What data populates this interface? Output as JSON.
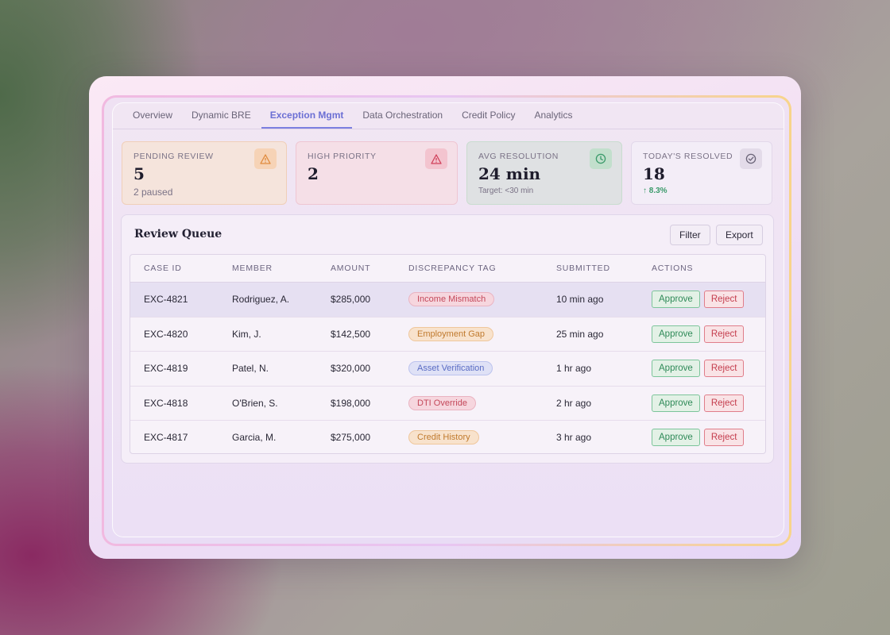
{
  "tabs": [
    "Overview",
    "Dynamic BRE",
    "Exception Mgmt",
    "Data Orchestration",
    "Credit Policy",
    "Analytics"
  ],
  "active_tab": "Exception Mgmt",
  "stats": {
    "pending": {
      "label": "PENDING REVIEW",
      "value": "5",
      "sub": "2 paused",
      "icon": "warning-triangle-icon"
    },
    "priority": {
      "label": "HIGH PRIORITY",
      "value": "2",
      "icon": "alert-triangle-icon"
    },
    "resolution": {
      "label": "AVG RESOLUTION",
      "value": "24 min",
      "sub": "Target: <30 min",
      "icon": "clock-icon"
    },
    "resolved": {
      "label": "TODAY'S RESOLVED",
      "value": "18",
      "sub": "↑ 8.3%",
      "icon": "check-circle-icon"
    }
  },
  "queue": {
    "title": "Review Queue",
    "filter_label": "Filter",
    "export_label": "Export",
    "columns": [
      "CASE ID",
      "MEMBER",
      "AMOUNT",
      "DISCREPANCY TAG",
      "SUBMITTED",
      "ACTIONS"
    ],
    "rows": [
      {
        "case_id": "EXC-4821",
        "member": "Rodriguez, A.",
        "amount": "$285,000",
        "tag": "Income Mismatch",
        "submitted": "10 min ago",
        "approve": "Approve",
        "reject": "Reject"
      },
      {
        "case_id": "EXC-4820",
        "member": "Kim, J.",
        "amount": "$142,500",
        "tag": "Employment Gap",
        "submitted": "25 min ago",
        "approve": "Approve",
        "reject": "Reject"
      },
      {
        "case_id": "EXC-4819",
        "member": "Patel, N.",
        "amount": "$320,000",
        "tag": "Asset Verification",
        "submitted": "1 hr ago",
        "approve": "Approve",
        "reject": "Reject"
      },
      {
        "case_id": "EXC-4818",
        "member": "O'Brien, S.",
        "amount": "$198,000",
        "tag": "DTI Override",
        "submitted": "2 hr ago",
        "approve": "Approve",
        "reject": "Reject"
      },
      {
        "case_id": "EXC-4817",
        "member": "Garcia, M.",
        "amount": "$275,000",
        "tag": "Credit History",
        "submitted": "3 hr ago",
        "approve": "Approve",
        "reject": "Reject"
      }
    ]
  },
  "colors": {
    "accent": "#6b6fd4",
    "approve": "#2f8a58",
    "reject": "#c43c4c"
  }
}
